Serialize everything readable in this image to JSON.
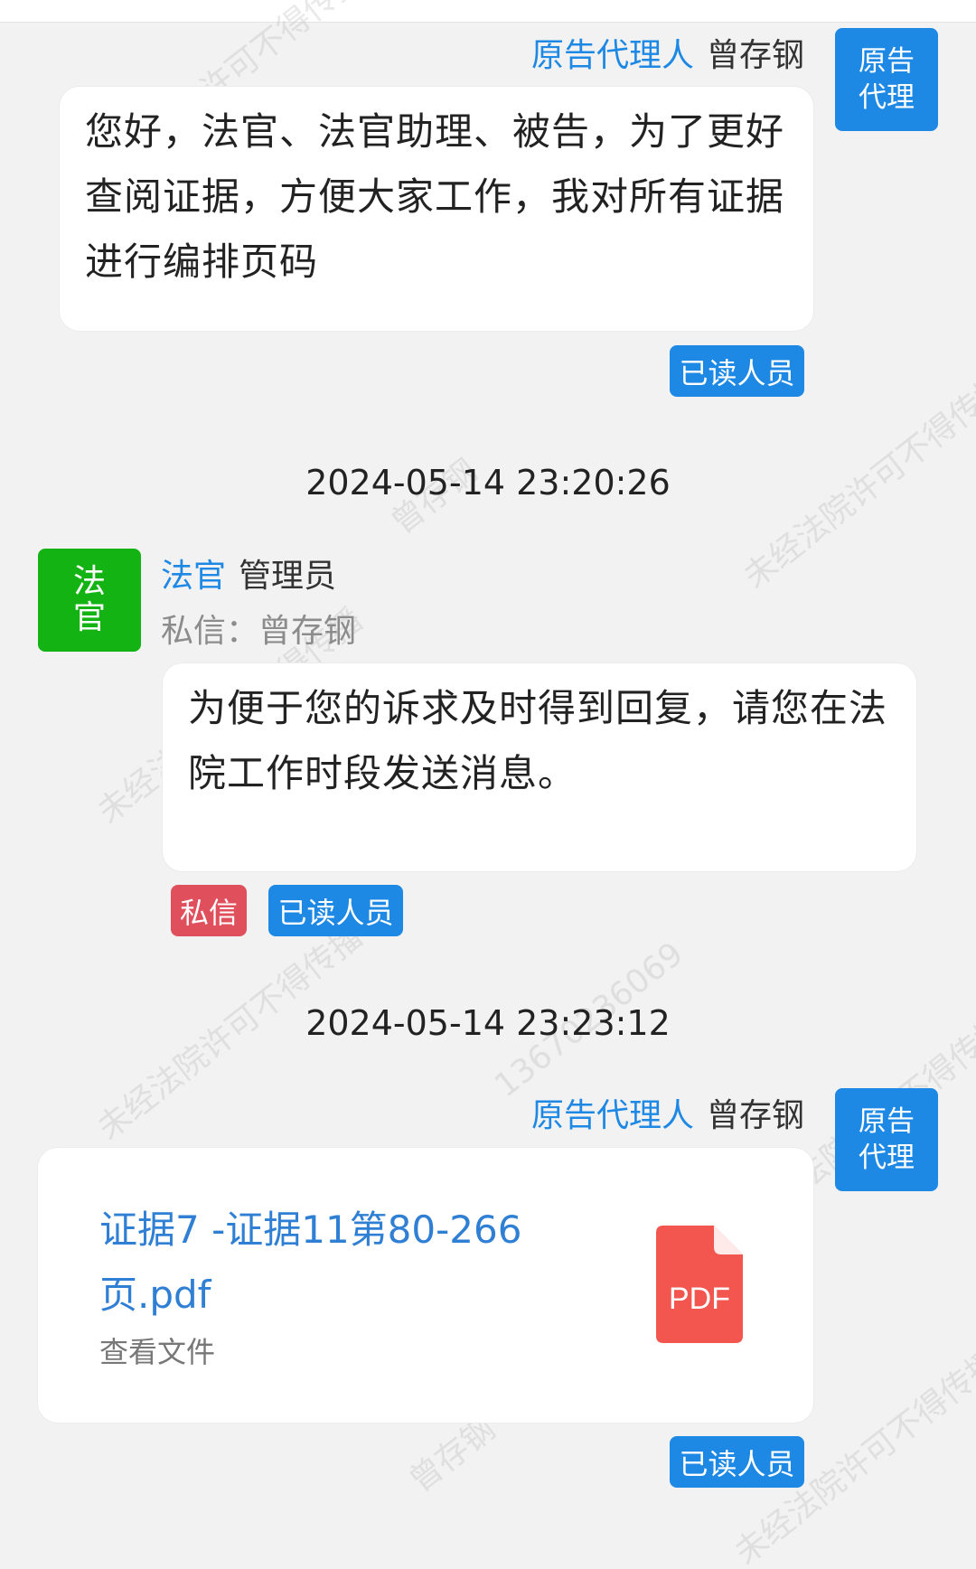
{
  "watermark": {
    "lines": [
      "未经法院许可不得传播",
      "13670236069",
      "曾存钢"
    ]
  },
  "messages": [
    {
      "role": "原告代理人",
      "name": "曾存钢",
      "avatar": "原告代理",
      "text": "您好，法官、法官助理、被告，为了更好查阅证据，方便大家工作，我对所有证据进行编排页码",
      "read_label": "已读人员"
    },
    {
      "timestamp": "2024-05-14 23:20:26",
      "role": "法官",
      "name": "管理员",
      "avatar": "法官",
      "private_to": "私信：曾存钢",
      "text": "为便于您的诉求及时得到回复，请您在法院工作时段发送消息。",
      "private_label": "私信",
      "read_label": "已读人员"
    },
    {
      "timestamp": "2024-05-14 23:23:12",
      "role": "原告代理人",
      "name": "曾存钢",
      "avatar": "原告代理",
      "file_name": "证据7 -证据11第80-266页.pdf",
      "view_label": "查看文件",
      "file_icon": "pdf-file-icon",
      "file_icon_text": "PDF",
      "read_label": "已读人员"
    }
  ],
  "colors": {
    "accent": "#1e88e5",
    "judge_avatar": "#12b312",
    "private_badge": "#e0505c",
    "pdf_icon": "#f2564f"
  }
}
